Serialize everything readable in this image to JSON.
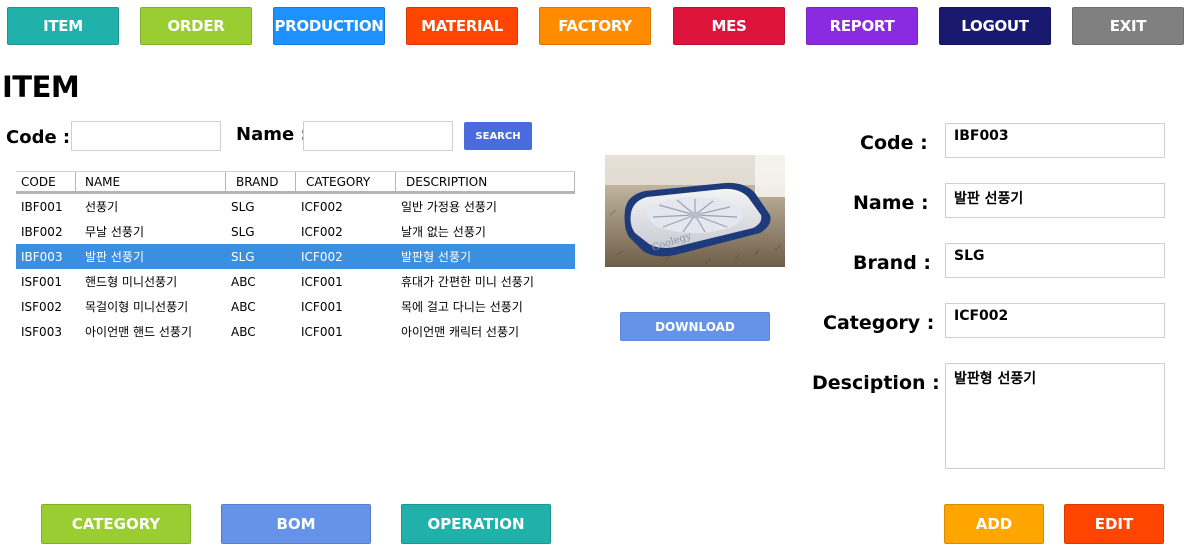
{
  "nav": [
    {
      "label": "ITEM",
      "color": "#20b2aa"
    },
    {
      "label": "ORDER",
      "color": "#9acd32"
    },
    {
      "label": "PRODUCTION",
      "color": "#1e90ff"
    },
    {
      "label": "MATERIAL",
      "color": "#ff4500"
    },
    {
      "label": "FACTORY",
      "color": "#ff8c00"
    },
    {
      "label": "MES",
      "color": "#dc143c"
    },
    {
      "label": "REPORT",
      "color": "#8a2be2"
    },
    {
      "label": "LOGOUT",
      "color": "#191970"
    },
    {
      "label": "EXIT",
      "color": "#808080"
    }
  ],
  "page_title": "ITEM",
  "search": {
    "code_label": "Code :",
    "code_value": "",
    "name_label": "Name :",
    "name_value": "",
    "button_label": "SEARCH"
  },
  "table": {
    "columns": [
      "CODE",
      "NAME",
      "BRAND",
      "CATEGORY",
      "DESCRIPTION"
    ],
    "rows": [
      [
        "IBF001",
        "선풍기",
        "SLG",
        "ICF002",
        "일반 가정용 선풍기"
      ],
      [
        "IBF002",
        "무날 선풍기",
        "SLG",
        "ICF002",
        "날개 없는 선풍기"
      ],
      [
        "IBF003",
        "발판 선풍기",
        "SLG",
        "ICF002",
        "발판형 선풍기"
      ],
      [
        "ISF001",
        "핸드형 미니선풍기",
        "ABC",
        "ICF001",
        "휴대가 간편한 미니 선풍기"
      ],
      [
        "ISF002",
        "목걸이형 미니선풍기",
        "ABC",
        "ICF001",
        "목에 걸고 다니는 선풍기"
      ],
      [
        "ISF003",
        "아이언맨 핸드 선풍기",
        "ABC",
        "ICF001",
        "아이언맨 캐릭터 선풍기"
      ]
    ],
    "selected_index": 2,
    "selected_color": "#3b8fe0"
  },
  "image_watermark": "Coolegy",
  "download_label": "DOWNLOAD",
  "detail": {
    "code_label": "Code :",
    "code_value": "IBF003",
    "name_label": "Name :",
    "name_value": "발판 선풍기",
    "brand_label": "Brand :",
    "brand_value": "SLG",
    "category_label": "Category :",
    "category_value": "ICF002",
    "description_label": "Desciption :",
    "description_value": "발판형 선풍기"
  },
  "bottom": {
    "category_label": "CATEGORY",
    "bom_label": "BOM",
    "operation_label": "OPERATION",
    "add_label": "ADD",
    "edit_label": "EDIT"
  },
  "colors": {
    "category": "#9acd32",
    "bom": "#6593ea",
    "operation": "#20b2aa",
    "add": "#ffa500",
    "edit": "#ff4500",
    "search": "#4a6bde",
    "download": "#6593ea"
  }
}
